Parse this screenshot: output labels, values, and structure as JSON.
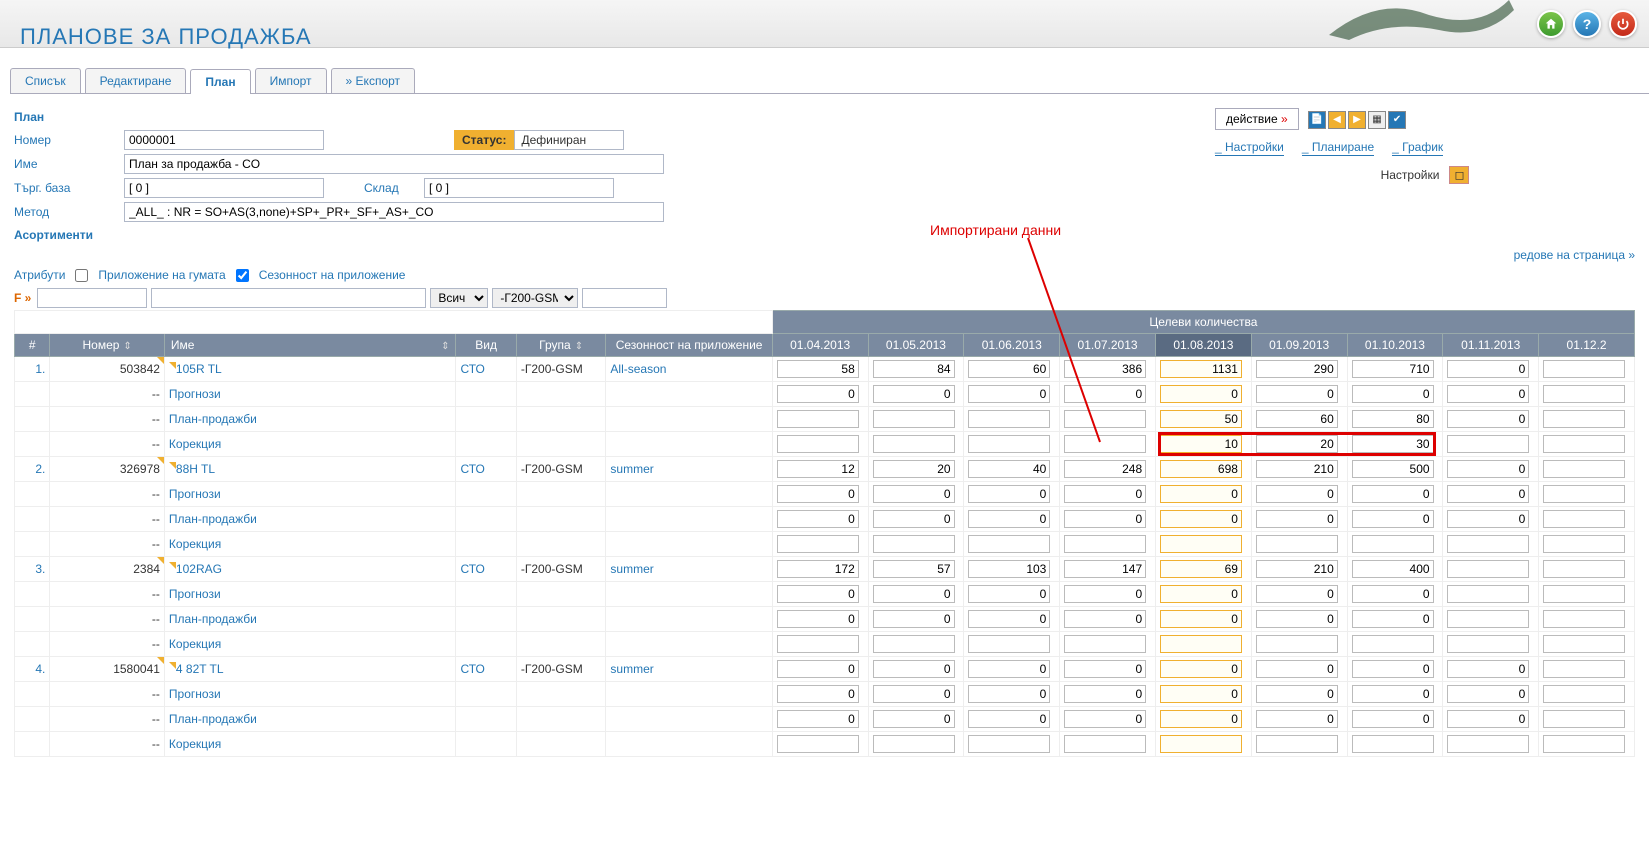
{
  "page_title": "ПЛАНОВЕ ЗА ПРОДАЖБА",
  "tabs": [
    "Списък",
    "Редактиране",
    "План",
    "Импорт",
    "» Експорт"
  ],
  "active_tab_index": 2,
  "section_plan": "План",
  "form": {
    "number_label": "Номер",
    "number_value": "0000001",
    "status_label": "Статус:",
    "status_value": "Дефиниран",
    "name_label": "Име",
    "name_value": "План за продажба - CO",
    "tbase_label": "Търг. база",
    "tbase_value": "[ 0 ]",
    "store_label": "Склад",
    "store_value": "[ 0 ]",
    "method_label": "Метод",
    "method_value": "_ALL_ : NR = SO+AS(3,none)+SP+_PR+_SF+_AS+_CO"
  },
  "action": {
    "label": "действие",
    "arrow": "»"
  },
  "sub_tabs": [
    "_ Настройки",
    "_ Планиране",
    "_ График"
  ],
  "settings": {
    "label": "Настройки"
  },
  "callout": "Импортирани данни",
  "rows_per_page": "редове на страница »",
  "assortments": "Асортименти",
  "attributes": {
    "label": "Атрибути",
    "tire_app": "Приложение на гумата",
    "seasonality": "Сезонност на приложение"
  },
  "filter": {
    "f_label": "F »",
    "all": "Всич",
    "group_selected": "-Г200-GSM"
  },
  "target_header": "Целеви количества",
  "columns": {
    "idx": "#",
    "number": "Номер",
    "name": "Име",
    "kind": "Вид",
    "group": "Група",
    "season": "Сезонност на приложение"
  },
  "months": [
    "01.04.2013",
    "01.05.2013",
    "01.06.2013",
    "01.07.2013",
    "01.08.2013",
    "01.09.2013",
    "01.10.2013",
    "01.11.2013",
    "01.12.2"
  ],
  "active_month_index": 4,
  "sub_row_labels": {
    "prognosis": "Прогнози",
    "plan_sales": "План-продажби",
    "correction": "Корекция"
  },
  "rows": [
    {
      "idx": "1.",
      "number": "503842",
      "name": "105R TL",
      "kind": "СТО",
      "group": "-Г200-GSM",
      "season": "All-season",
      "vals": [
        "58",
        "84",
        "60",
        "386",
        "1131",
        "290",
        "710",
        "0",
        ""
      ],
      "prognosis": [
        "0",
        "0",
        "0",
        "0",
        "0",
        "0",
        "0",
        "0",
        ""
      ],
      "plan_sales": [
        "",
        "",
        "",
        "",
        "50",
        "60",
        "80",
        "0",
        ""
      ],
      "correction": [
        "",
        "",
        "",
        "",
        "10",
        "20",
        "30",
        "",
        ""
      ]
    },
    {
      "idx": "2.",
      "number": "326978",
      "name": "88H TL",
      "kind": "СТО",
      "group": "-Г200-GSM",
      "season": "summer",
      "vals": [
        "12",
        "20",
        "40",
        "248",
        "698",
        "210",
        "500",
        "0",
        ""
      ],
      "prognosis": [
        "0",
        "0",
        "0",
        "0",
        "0",
        "0",
        "0",
        "0",
        ""
      ],
      "plan_sales": [
        "0",
        "0",
        "0",
        "0",
        "0",
        "0",
        "0",
        "0",
        ""
      ],
      "correction": [
        "",
        "",
        "",
        "",
        "",
        "",
        "",
        "",
        ""
      ]
    },
    {
      "idx": "3.",
      "number": "2384",
      "name": "102RAG",
      "kind": "СТО",
      "group": "-Г200-GSM",
      "season": "summer",
      "vals": [
        "172",
        "57",
        "103",
        "147",
        "69",
        "210",
        "400",
        "",
        ""
      ],
      "prognosis": [
        "0",
        "0",
        "0",
        "0",
        "0",
        "0",
        "0",
        "",
        ""
      ],
      "plan_sales": [
        "0",
        "0",
        "0",
        "0",
        "0",
        "0",
        "0",
        "",
        ""
      ],
      "correction": [
        "",
        "",
        "",
        "",
        "",
        "",
        "",
        "",
        ""
      ]
    },
    {
      "idx": "4.",
      "number": "1580041",
      "name": "4 82T TL",
      "kind": "СТО",
      "group": "-Г200-GSM",
      "season": "summer",
      "vals": [
        "0",
        "0",
        "0",
        "0",
        "0",
        "0",
        "0",
        "0",
        ""
      ],
      "prognosis": [
        "0",
        "0",
        "0",
        "0",
        "0",
        "0",
        "0",
        "0",
        ""
      ],
      "plan_sales": [
        "0",
        "0",
        "0",
        "0",
        "0",
        "0",
        "0",
        "0",
        ""
      ],
      "correction": [
        "",
        "",
        "",
        "",
        "",
        "",
        "",
        "",
        ""
      ]
    }
  ]
}
